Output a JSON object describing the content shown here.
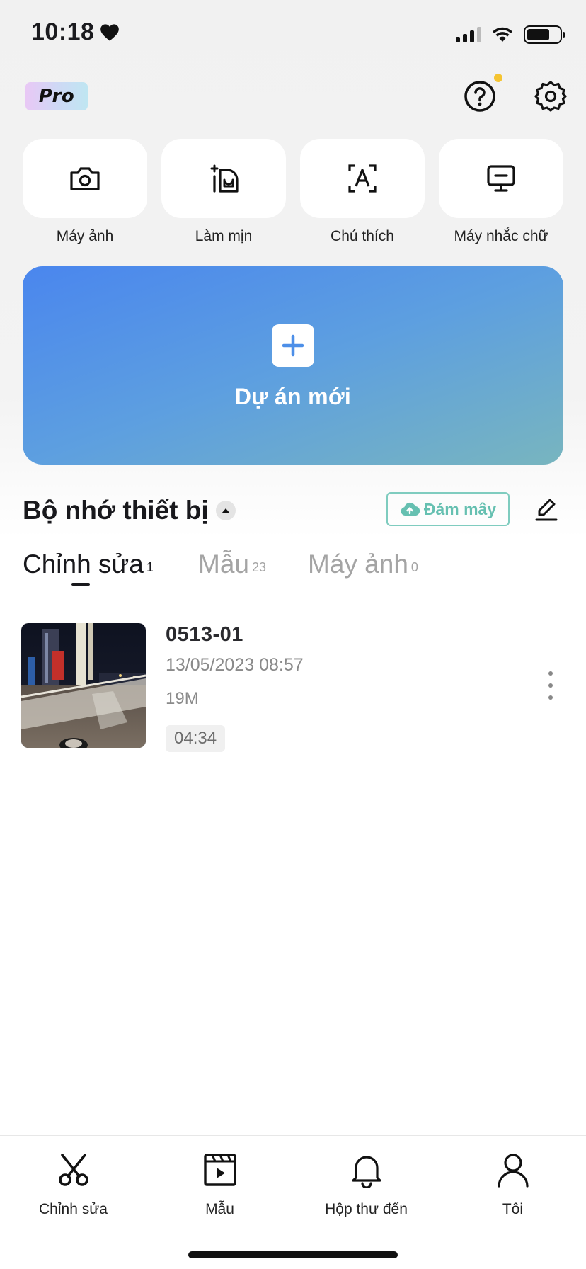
{
  "status_bar": {
    "time": "10:18"
  },
  "header": {
    "pro_badge": "Pro"
  },
  "tools": [
    {
      "label": "Máy ảnh",
      "icon": "camera-icon"
    },
    {
      "label": "Làm mịn",
      "icon": "smooth-face-icon"
    },
    {
      "label": "Chú thích",
      "icon": "caption-icon"
    },
    {
      "label": "Máy nhắc chữ",
      "icon": "teleprompter-icon"
    }
  ],
  "new_project": {
    "label": "Dự án mới"
  },
  "storage": {
    "title": "Bộ nhớ thiết bị",
    "cloud_label": "Đám mây"
  },
  "tabs": [
    {
      "label": "Chỉnh sửa",
      "count": "1",
      "active": true
    },
    {
      "label": "Mẫu",
      "count": "23",
      "active": false
    },
    {
      "label": "Máy ảnh",
      "count": "0",
      "active": false
    }
  ],
  "projects": [
    {
      "name": "0513-01",
      "date": "13/05/2023 08:57",
      "size": "19M",
      "duration": "04:34"
    }
  ],
  "bottom_nav": [
    {
      "label": "Chỉnh sửa",
      "icon": "scissors-icon"
    },
    {
      "label": "Mẫu",
      "icon": "template-icon"
    },
    {
      "label": "Hộp thư đến",
      "icon": "bell-icon"
    },
    {
      "label": "Tôi",
      "icon": "profile-icon"
    }
  ],
  "colors": {
    "accent_cloud": "#66c0b1",
    "new_project_start": "#4a86ee",
    "new_project_end": "#78b5bf",
    "notification_dot": "#f5c431"
  }
}
